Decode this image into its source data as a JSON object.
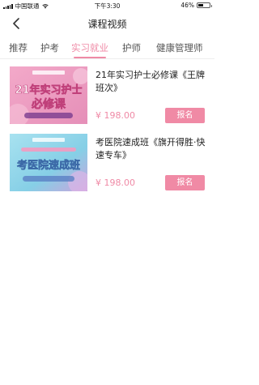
{
  "status_bar": {
    "carrier": "中国联通",
    "time": "下午3:30",
    "battery_text": "46%",
    "battery_level": 0.46
  },
  "nav": {
    "title": "课程视频",
    "back_icon": "chevron-left-icon"
  },
  "tabs": [
    {
      "label": "推荐",
      "active": false
    },
    {
      "label": "护考",
      "active": false
    },
    {
      "label": "实习就业",
      "active": true
    },
    {
      "label": "护师",
      "active": false
    },
    {
      "label": "健康管理师",
      "active": false
    }
  ],
  "courses": [
    {
      "title": "21年实习护士必修课《王牌班次》",
      "price": "¥ 198.00",
      "button": "报名",
      "thumb_title": [
        "21年实习护士",
        "必修课"
      ]
    },
    {
      "title": "考医院速成班《旗开得胜·快速专车》",
      "price": "¥ 198.00",
      "button": "报名",
      "thumb_title": [
        "考医院速成班"
      ]
    }
  ],
  "colors": {
    "accent": "#ef8aa6",
    "thumb1_bg": "#ef9fc0",
    "thumb2_bg": "#8fd3e8"
  }
}
